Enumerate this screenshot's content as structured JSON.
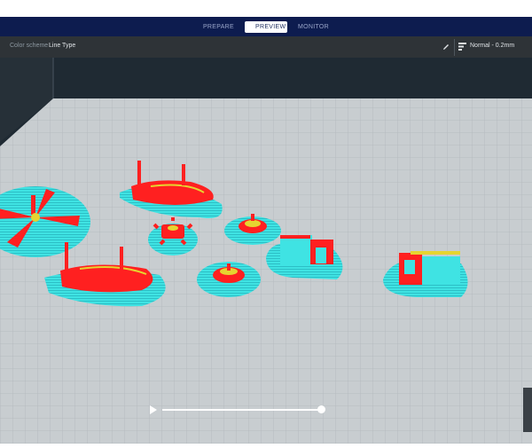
{
  "stages": [
    "PREPARE",
    "PREVIEW",
    "MONITOR"
  ],
  "active_stage": "PREVIEW",
  "toolbar": {
    "color_scheme_label": "Color scheme",
    "color_scheme_value": "Line Type",
    "edit_icon": "pencil-icon",
    "profile_icon": "print-settings-icon",
    "profile_label": "Normal - 0.2mm"
  },
  "simulation": {
    "play_icon": "play-icon",
    "progress": 1.0
  },
  "colors": {
    "stage_bar": "#0d1c4f",
    "toolbar": "#2e3337",
    "background": "#1f2a33",
    "build_plate": "#c8cdd0",
    "grid": "#aeb4b8",
    "skirt": "#3fe3e3",
    "wall_outer": "#ff2020",
    "top_skin": "#e6d430"
  }
}
